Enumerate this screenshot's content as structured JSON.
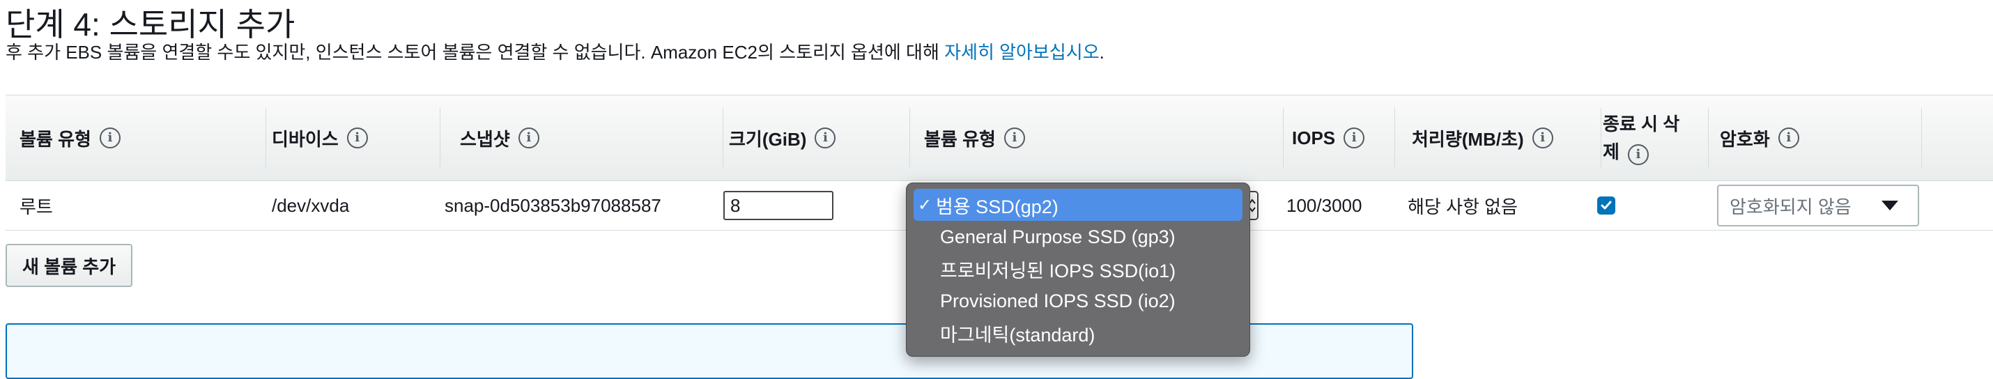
{
  "header": {
    "title": "단계 4: 스토리지 추가",
    "subtitle": "후 추가 EBS 볼륨을 연결할 수도 있지만, 인스턴스 스토어 볼륨은 연결할 수 없습니다. Amazon EC2의 스토리지 옵션에 대해 ",
    "link": "자세히 알아보십시오",
    "period": "."
  },
  "table": {
    "headers": {
      "volume_type": "볼륨 유형",
      "device": "디바이스",
      "snapshot": "스냅샷",
      "size": "크기(GiB)",
      "volume_type2": "볼륨 유형",
      "iops": "IOPS",
      "throughput": "처리량(MB/초)",
      "delete_line1": "종료 시 삭",
      "delete_line2": "제",
      "encryption": "암호화"
    },
    "row": {
      "volume_type": "루트",
      "device": "/dev/xvda",
      "snapshot": "snap-0d503853b97088587",
      "size": "8",
      "iops": "100/3000",
      "throughput": "해당 사항 없음",
      "delete_on_termination": true,
      "encryption": "암호화되지 않음"
    }
  },
  "buttons": {
    "add_volume": "새 볼륨 추가"
  },
  "dropdown": {
    "selected_index": 0,
    "options": [
      "범용 SSD(gp2)",
      "General Purpose SSD (gp3)",
      "프로비저닝된 IOPS SSD(io1)",
      "Provisioned IOPS SSD (io2)",
      "마그네틱(standard)"
    ]
  },
  "colors": {
    "link": "#0073bb",
    "selected_option": "#4f8fe8",
    "dropdown_bg": "#6c6c6e",
    "checkbox": "#0073bb"
  }
}
